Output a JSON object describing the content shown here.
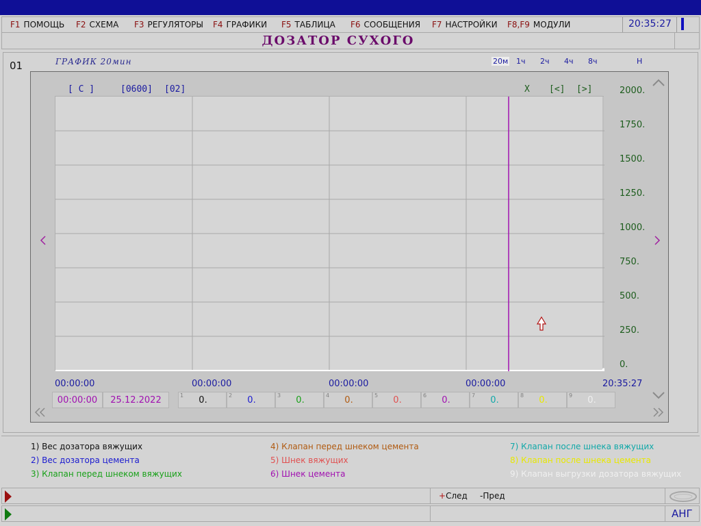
{
  "menu": [
    {
      "key": "F1",
      "label": "ПОМОЩЬ"
    },
    {
      "key": "F2",
      "label": "СХЕМА"
    },
    {
      "key": "F3",
      "label": "РЕГУЛЯТОРЫ"
    },
    {
      "key": "F4",
      "label": "ГРАФИКИ"
    },
    {
      "key": "F5",
      "label": "ТАБЛИЦА"
    },
    {
      "key": "F6",
      "label": "СООБЩЕНИЯ"
    },
    {
      "key": "F7",
      "label": "НАСТРОЙКИ"
    },
    {
      "key": "F8,F9",
      "label": "МОДУЛИ"
    }
  ],
  "clock": "20:35:27",
  "page_title": "ДОЗАТОР СУХОГО",
  "screen_number": "01",
  "graph": {
    "title": "ГРАФИК 20мин",
    "ranges": [
      "20м",
      "1ч",
      "2ч",
      "4ч",
      "8ч"
    ],
    "active_range": "20м",
    "h_label": "Н",
    "header": {
      "channel": "[ С ]",
      "value1": "[0600]",
      "value2": "[02]",
      "x": "Х",
      "prev": "[<]",
      "next": "[>]"
    }
  },
  "chart_data": {
    "type": "line",
    "y_ticks": [
      "2000.",
      "1750.",
      "1500.",
      "1250.",
      "1000.",
      "750.",
      "500.",
      "250.",
      "0."
    ],
    "ylim": [
      0,
      2000
    ],
    "x_ticks": [
      "00:00:00",
      "00:00:00",
      "00:00:00",
      "00:00:00",
      "20:35:27"
    ],
    "grid": true,
    "cursor_marker": true,
    "series": [
      {
        "values": [
          0,
          0
        ]
      }
    ]
  },
  "footer": {
    "time": "00:00:00",
    "date": "25.12.2022",
    "channels": [
      {
        "n": "1",
        "v": "0.",
        "color": "#111111"
      },
      {
        "n": "2",
        "v": "0.",
        "color": "#1a1ad0"
      },
      {
        "n": "3",
        "v": "0.",
        "color": "#18a018"
      },
      {
        "n": "4",
        "v": "0.",
        "color": "#b05a10"
      },
      {
        "n": "5",
        "v": "0.",
        "color": "#e05050"
      },
      {
        "n": "6",
        "v": "0.",
        "color": "#a010b0"
      },
      {
        "n": "7",
        "v": "0.",
        "color": "#10a8a8"
      },
      {
        "n": "8",
        "v": "0.",
        "color": "#e8e800"
      },
      {
        "n": "9",
        "v": "0.",
        "color": "#f0f0f0"
      }
    ]
  },
  "legend": [
    {
      "text": "1) Вес дозатора вяжущих",
      "color": "#111111"
    },
    {
      "text": "2) Вес дозатора цемента",
      "color": "#1a1ad0"
    },
    {
      "text": "3) Клапан перед шнеком вяжущих",
      "color": "#18a018"
    },
    {
      "text": "4) Клапан перед шнеком цемента",
      "color": "#b05a10"
    },
    {
      "text": "5) Шнек вяжущих",
      "color": "#e05050"
    },
    {
      "text": "6) Шнек цемента",
      "color": "#a010b0"
    },
    {
      "text": "7) Клапан после шнека вяжущих",
      "color": "#10a8a8"
    },
    {
      "text": "8) Клапан после шнека цемента",
      "color": "#e8e800"
    },
    {
      "text": "9) Клапан выгрузки дозатора вяжущих",
      "color": "#f0f0f0"
    }
  ],
  "status": {
    "next_label": "+След",
    "prev_label": "-Пред",
    "lang": "АНГ"
  }
}
